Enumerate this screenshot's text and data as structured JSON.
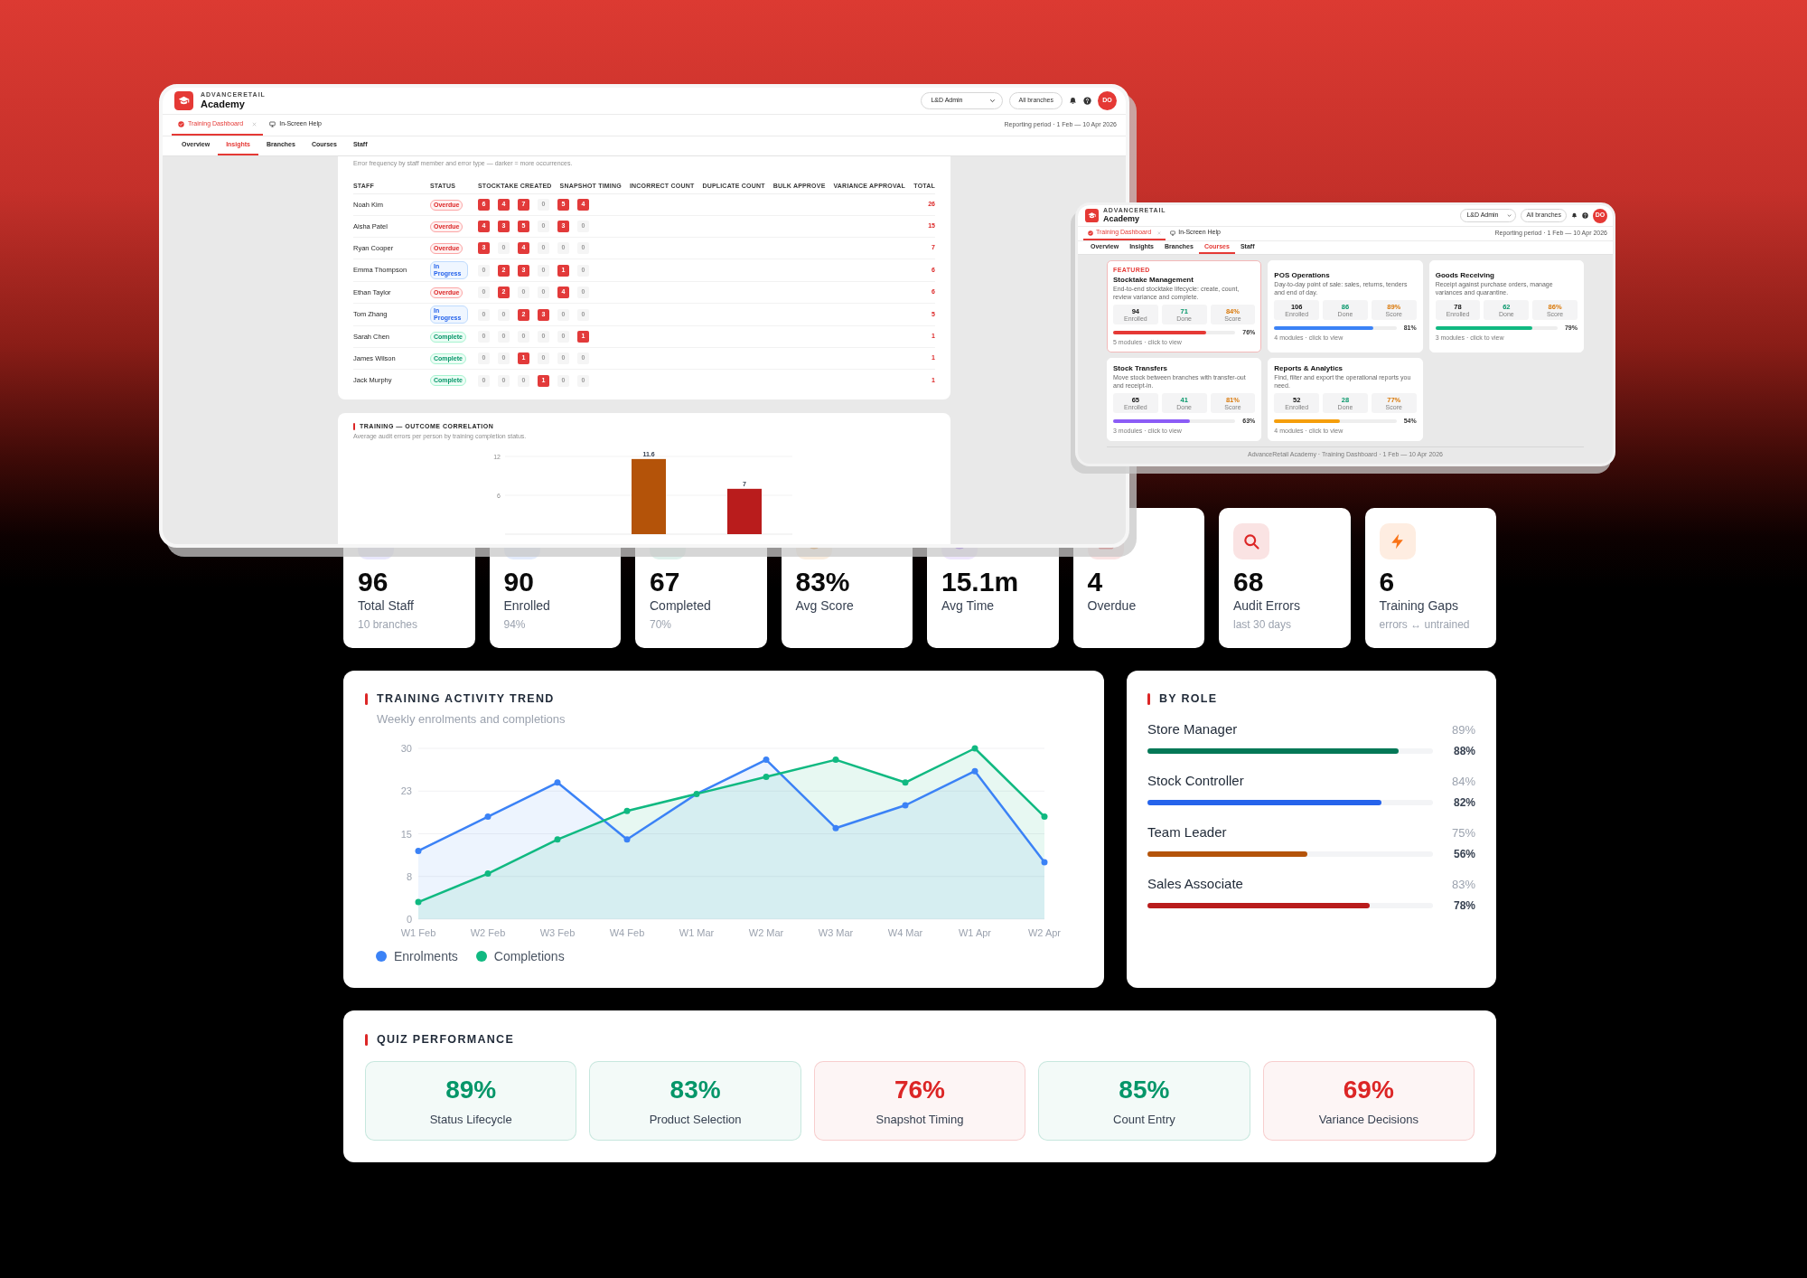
{
  "windows": [
    {
      "brand": "ADVANCERETAIL",
      "title": "Academy",
      "role_select": "L&D Admin",
      "branch_filter": "All branches",
      "avatar": "DO",
      "tabs": [
        {
          "label": "Training Dashboard",
          "selected": true,
          "closable": true
        },
        {
          "label": "In-Screen Help",
          "selected": false,
          "closable": false
        }
      ],
      "reporting_period": "Reporting period · 1 Feb — 10 Apr 2026",
      "nav": [
        {
          "label": "Overview",
          "selected": false
        },
        {
          "label": "Insights",
          "selected": true
        },
        {
          "label": "Branches",
          "selected": false
        },
        {
          "label": "Courses",
          "selected": false
        },
        {
          "label": "Staff",
          "selected": false
        }
      ],
      "error_matrix": {
        "subtitle": "Error frequency by staff member and error type — darker = more occurrences.",
        "columns": [
          "STAFF",
          "STATUS",
          "STOCKTAKE CREATED",
          "SNAPSHOT TIMING",
          "INCORRECT COUNT",
          "DUPLICATE COUNT",
          "BULK APPROVE",
          "VARIANCE APPROVAL",
          "TOTAL"
        ],
        "rows": [
          {
            "staff": "Noah Kim",
            "status": "Overdue",
            "kind": "overdue",
            "counts": [
              "6",
              "4",
              "7",
              "0",
              "5",
              "4"
            ],
            "total": "26"
          },
          {
            "staff": "Aisha Patel",
            "status": "Overdue",
            "kind": "overdue",
            "counts": [
              "4",
              "3",
              "5",
              "0",
              "3",
              "0"
            ],
            "total": "15"
          },
          {
            "staff": "Ryan Cooper",
            "status": "Overdue",
            "kind": "overdue",
            "counts": [
              "3",
              "0",
              "4",
              "0",
              "0",
              "0"
            ],
            "total": "7"
          },
          {
            "staff": "Emma Thompson",
            "status": "In Progress",
            "kind": "in_progress",
            "counts": [
              "0",
              "2",
              "3",
              "0",
              "1",
              "0"
            ],
            "total": "6"
          },
          {
            "staff": "Ethan Taylor",
            "status": "Overdue",
            "kind": "overdue",
            "counts": [
              "0",
              "2",
              "0",
              "0",
              "4",
              "0"
            ],
            "total": "6"
          },
          {
            "staff": "Tom Zhang",
            "status": "In Progress",
            "kind": "in_progress",
            "counts": [
              "0",
              "0",
              "2",
              "3",
              "0",
              "0"
            ],
            "total": "5"
          },
          {
            "staff": "Sarah Chen",
            "status": "Complete",
            "kind": "complete",
            "counts": [
              "0",
              "0",
              "0",
              "0",
              "0",
              "1"
            ],
            "total": "1"
          },
          {
            "staff": "James Wilson",
            "status": "Complete",
            "kind": "complete",
            "counts": [
              "0",
              "0",
              "1",
              "0",
              "0",
              "0"
            ],
            "total": "1"
          },
          {
            "staff": "Jack Murphy",
            "status": "Complete",
            "kind": "complete",
            "counts": [
              "0",
              "0",
              "0",
              "1",
              "0",
              "0"
            ],
            "total": "1"
          }
        ]
      },
      "correlation": {
        "chart_data": {
          "type": "bar",
          "title": "TRAINING — OUTCOME CORRELATION",
          "subtitle": "Average audit errors per person by training completion status.",
          "categories": [
            null,
            null,
            null
          ],
          "values": [
            null,
            11.6,
            7
          ],
          "colors": [
            null,
            "#b45309",
            "#b91c1c"
          ],
          "ylim": [
            0,
            12
          ],
          "yticks": [
            6,
            12
          ],
          "grid": true,
          "data_labels": true
        }
      }
    },
    {
      "brand": "ADVANCERETAIL",
      "title": "Academy",
      "role_select": "L&D Admin",
      "branch_filter": "All branches",
      "avatar": "DO",
      "tabs": [
        {
          "label": "Training Dashboard",
          "selected": true,
          "closable": true
        },
        {
          "label": "In-Screen Help",
          "selected": false,
          "closable": false
        }
      ],
      "reporting_period": "Reporting period · 1 Feb — 10 Apr 2026",
      "nav": [
        {
          "label": "Overview",
          "selected": false
        },
        {
          "label": "Insights",
          "selected": false
        },
        {
          "label": "Branches",
          "selected": false
        },
        {
          "label": "Courses",
          "selected": true
        },
        {
          "label": "Staff",
          "selected": false
        }
      ],
      "courses": [
        {
          "tag": "FEATURED",
          "featured": true,
          "title": "Stocktake Management",
          "description": "End-to-end stocktake lifecycle: create, count, review variance and complete.",
          "stats": [
            {
              "value": "94",
              "label": "Enrolled"
            },
            {
              "value": "71",
              "label": "Done"
            },
            {
              "value": "84%",
              "label": "Score"
            }
          ],
          "level": 0.76,
          "reading": "76%",
          "color": "#e53935",
          "meta": "5 modules · click to view"
        },
        {
          "featured": false,
          "title": "POS Operations",
          "description": "Day-to-day point of sale: sales, returns, tenders and end of day.",
          "stats": [
            {
              "value": "106",
              "label": "Enrolled"
            },
            {
              "value": "86",
              "label": "Done"
            },
            {
              "value": "89%",
              "label": "Score"
            }
          ],
          "level": 0.81,
          "reading": "81%",
          "color": "#3b82f6",
          "meta": "4 modules · click to view"
        },
        {
          "featured": false,
          "title": "Goods Receiving",
          "description": "Receipt against purchase orders, manage variances and quarantine.",
          "stats": [
            {
              "value": "78",
              "label": "Enrolled"
            },
            {
              "value": "62",
              "label": "Done"
            },
            {
              "value": "86%",
              "label": "Score"
            }
          ],
          "level": 0.79,
          "reading": "79%",
          "color": "#10b981",
          "meta": "3 modules · click to view"
        },
        {
          "featured": false,
          "title": "Stock Transfers",
          "description": "Move stock between branches with transfer-out and receipt-in.",
          "stats": [
            {
              "value": "65",
              "label": "Enrolled"
            },
            {
              "value": "41",
              "label": "Done"
            },
            {
              "value": "81%",
              "label": "Score"
            }
          ],
          "level": 0.63,
          "reading": "63%",
          "color": "#8b5cf6",
          "meta": "3 modules · click to view"
        },
        {
          "featured": false,
          "title": "Reports & Analytics",
          "description": "Find, filter and export the operational reports you need.",
          "stats": [
            {
              "value": "52",
              "label": "Enrolled"
            },
            {
              "value": "28",
              "label": "Done"
            },
            {
              "value": "77%",
              "label": "Score"
            }
          ],
          "level": 0.54,
          "reading": "54%",
          "color": "#f59e0b",
          "meta": "4 modules · click to view"
        }
      ],
      "footer": "AdvanceRetail Academy · Training Dashboard · 1 Feb — 10 Apr 2026"
    }
  ],
  "dashboard": {
    "stats": [
      {
        "value": "96",
        "label": "Total Staff",
        "sub": "10 branches"
      },
      {
        "value": "90",
        "label": "Enrolled",
        "sub": "94%"
      },
      {
        "value": "67",
        "label": "Completed",
        "sub": "70%"
      },
      {
        "value": "83%",
        "label": "Avg Score"
      },
      {
        "value": "15.1m",
        "label": "Avg Time"
      },
      {
        "value": "4",
        "label": "Overdue"
      },
      {
        "value": "68",
        "label": "Audit Errors",
        "sub": "last 30 days"
      },
      {
        "value": "6",
        "label": "Training Gaps",
        "sub": "errors ↔ untrained"
      }
    ],
    "trend": {
      "chart_data": {
        "type": "area",
        "title": "TRAINING ACTIVITY TREND",
        "subtitle": "Weekly enrolments and completions",
        "categories": [
          "W1 Feb",
          "W2 Feb",
          "W3 Feb",
          "W4 Feb",
          "W1 Mar",
          "W2 Mar",
          "W3 Mar",
          "W4 Mar",
          "W1 Apr",
          "W2 Apr"
        ],
        "ylim": [
          0,
          30
        ],
        "yticks": [
          0,
          {
            "value": 7.5,
            "label": "8"
          },
          15,
          {
            "value": 22.5,
            "label": "23"
          },
          30
        ],
        "grid": true,
        "marker": "circle",
        "legend": "bottom",
        "series": [
          {
            "name": "Enrolments",
            "color": "#3b82f6",
            "values": [
              12,
              18,
              24,
              14,
              22,
              28,
              16,
              20,
              26,
              10
            ]
          },
          {
            "name": "Completions",
            "color": "#10b981",
            "values": [
              3,
              8,
              14,
              19,
              22,
              25,
              28,
              24,
              30,
              18
            ]
          }
        ]
      }
    },
    "by_role": {
      "title": "BY ROLE",
      "roles": [
        {
          "name": "Store Manager",
          "note": "89%",
          "level": 0.88,
          "reading": "88%",
          "color": "#047857"
        },
        {
          "name": "Stock Controller",
          "note": "84%",
          "level": 0.82,
          "reading": "82%",
          "color": "#2563eb"
        },
        {
          "name": "Team Leader",
          "note": "75%",
          "level": 0.56,
          "reading": "56%",
          "color": "#b45309"
        },
        {
          "name": "Sales Associate",
          "note": "83%",
          "level": 0.78,
          "reading": "78%",
          "color": "#b91c1c"
        }
      ]
    },
    "quiz": {
      "title": "QUIZ PERFORMANCE",
      "topics": [
        {
          "score": "89%",
          "label": "Status Lifecycle",
          "color": "#059669"
        },
        {
          "score": "83%",
          "label": "Product Selection",
          "color": "#059669"
        },
        {
          "score": "76%",
          "label": "Snapshot Timing",
          "color": "#dc2626"
        },
        {
          "score": "85%",
          "label": "Count Entry",
          "color": "#059669"
        },
        {
          "score": "69%",
          "label": "Variance Decisions",
          "color": "#dc2626"
        }
      ]
    }
  }
}
